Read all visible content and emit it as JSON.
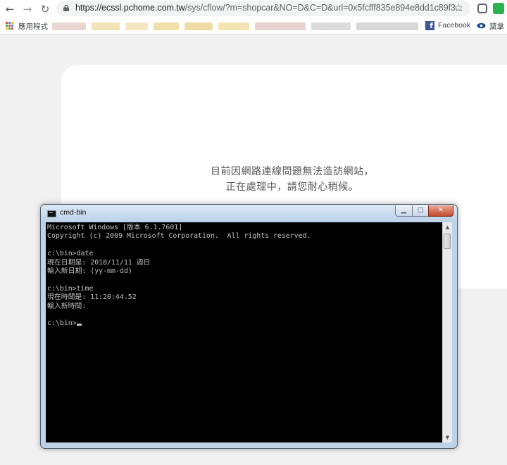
{
  "browser": {
    "url_host": "https://ecssl.pchome.com.tw",
    "url_path": "/sys/cflow/?m=shopcar&NO=D&C=D&url=0x5fcfff835e894e8dd1c89f3...",
    "bookmarks": {
      "apps_label": "應用程式",
      "facebook_label": "Facebook",
      "last_label": "黛拿"
    }
  },
  "page": {
    "message_line1": "目前因網路連線問題無法造訪網站，",
    "message_line2": "正在處理中，請您耐心稍候。"
  },
  "cmd_window": {
    "title": "cmd-bin",
    "buttons": {
      "minimize": "▁",
      "maximize": "□",
      "close": "✕"
    },
    "lines": [
      "Microsoft Windows [版本 6.1.7601]",
      "Copyright (c) 2009 Microsoft Corporation.  All rights reserved.",
      "",
      "c:\\bin>date",
      "現在日期是: 2018/11/11 週日",
      "輸入新日期: (yy-mm-dd)",
      "",
      "c:\\bin>time",
      "現在時間是: 11:20:44.52",
      "輸入新時間:",
      "",
      "c:\\bin>"
    ]
  },
  "icons": {
    "back": "arrow-left-icon",
    "forward": "arrow-right-icon",
    "reload": "reload-icon",
    "lock": "lock-icon",
    "star": "star-icon"
  },
  "colors": {
    "console_bg": "#000000",
    "console_text": "#c0c0c0",
    "facebook": "#3b5998"
  }
}
